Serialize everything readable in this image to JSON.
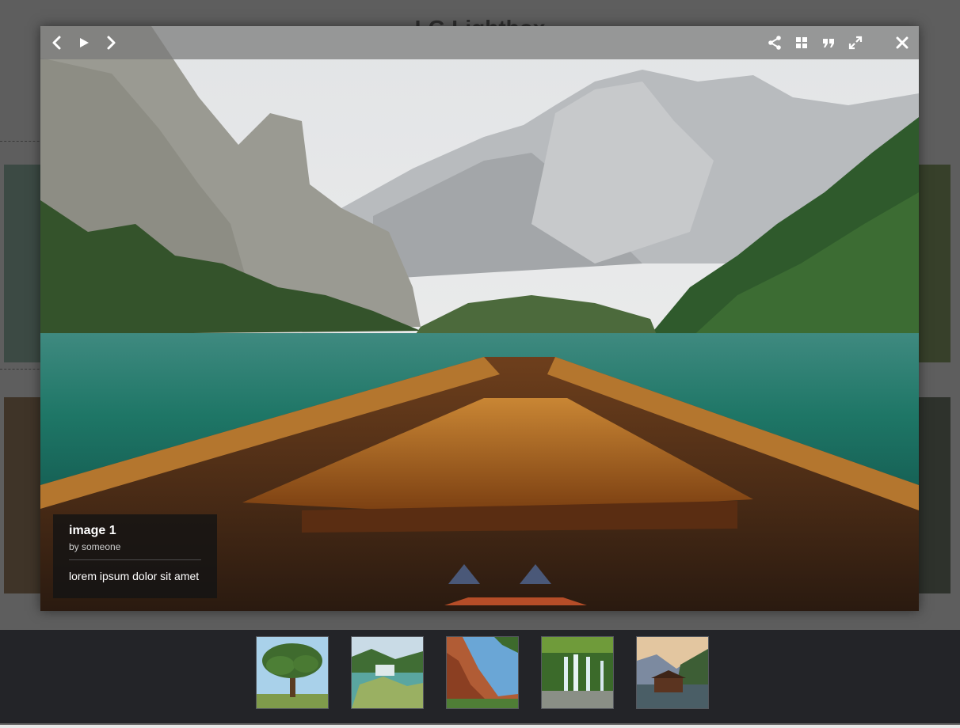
{
  "page": {
    "background_title": "LG Lightbox"
  },
  "toolbar": {
    "left": [
      {
        "name": "prev-button",
        "icon": "chevron-left-icon"
      },
      {
        "name": "autoplay-button",
        "icon": "play-icon"
      },
      {
        "name": "next-button",
        "icon": "chevron-right-icon"
      }
    ],
    "right": [
      {
        "name": "share-button",
        "icon": "share-icon"
      },
      {
        "name": "thumbnails-toggle-button",
        "icon": "grid-icon"
      },
      {
        "name": "comments-button",
        "icon": "quote-icon"
      },
      {
        "name": "fullscreen-button",
        "icon": "expand-icon"
      },
      {
        "name": "close-button",
        "icon": "close-icon"
      }
    ]
  },
  "slide": {
    "image": "lake-boat-mountains",
    "title": "image 1",
    "author": "by someone",
    "description": "lorem ipsum dolor sit amet"
  },
  "thumbnails": [
    {
      "image": "lone-tree"
    },
    {
      "image": "river-falls"
    },
    {
      "image": "red-canyon"
    },
    {
      "image": "waterfall-forest"
    },
    {
      "image": "lake-boathouse"
    }
  ],
  "colors": {
    "toolbar_bg": "#787878",
    "caption_bg": "#141414",
    "thumbbar_bg": "#232428",
    "overlay_bg": "#5e5e5e"
  }
}
